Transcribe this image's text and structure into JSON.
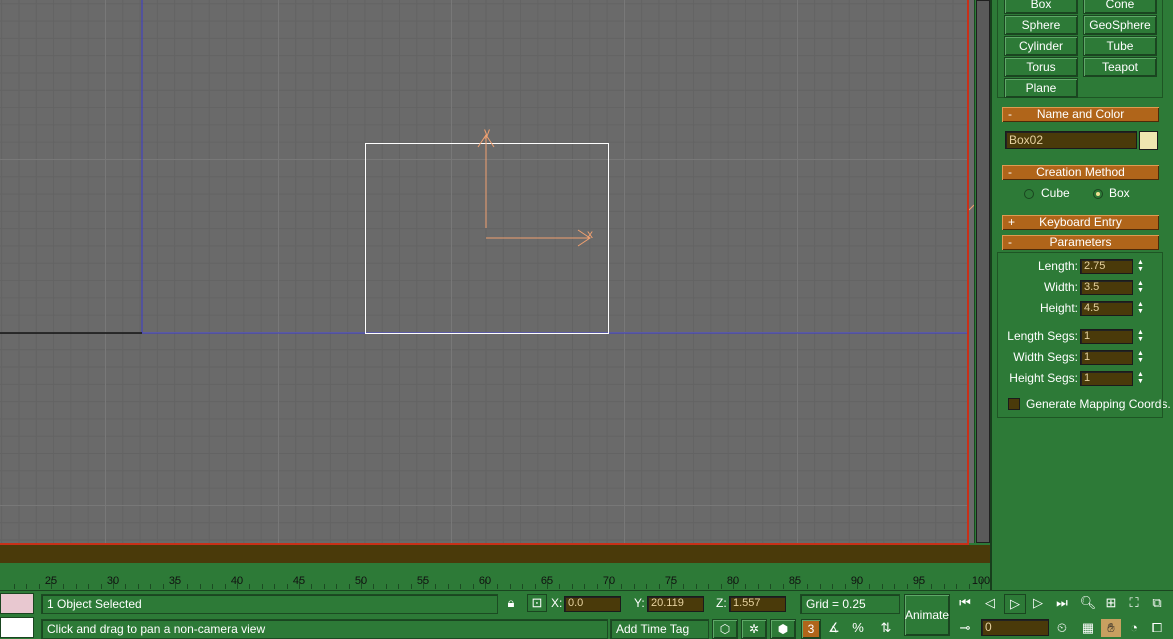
{
  "viewport": {
    "gizmo_y_label": "y",
    "gizmo_x_label": "x"
  },
  "panel": {
    "object_types": [
      "Box",
      "Cone",
      "Sphere",
      "GeoSphere",
      "Cylinder",
      "Tube",
      "Torus",
      "Teapot",
      "Plane"
    ],
    "name_and_color": {
      "sign": "-",
      "title": "Name and Color",
      "name_value": "Box02",
      "color": "#f0e6b0"
    },
    "creation_method": {
      "sign": "-",
      "title": "Creation Method",
      "option_cube": "Cube",
      "option_box": "Box",
      "selected": "Box"
    },
    "keyboard_entry": {
      "sign": "+",
      "title": "Keyboard Entry"
    },
    "parameters": {
      "sign": "-",
      "title": "Parameters",
      "length_label": "Length:",
      "length": "2.75",
      "width_label": "Width:",
      "width": "3.5",
      "height_label": "Height:",
      "height": "4.5",
      "length_segs_label": "Length Segs:",
      "length_segs": "1",
      "width_segs_label": "Width Segs:",
      "width_segs": "1",
      "height_segs_label": "Height Segs:",
      "height_segs": "1",
      "mapping_label": "Generate Mapping Coords.",
      "mapping_checked": false
    }
  },
  "timeline": {
    "ticks": [
      "25",
      "30",
      "35",
      "40",
      "45",
      "50",
      "55",
      "60",
      "65",
      "70",
      "75",
      "80",
      "85",
      "90",
      "95",
      "100"
    ]
  },
  "status": {
    "selection": "1 Object Selected",
    "prompt": "Click and drag to pan a non-camera view",
    "x_label": "X:",
    "x_value": "0.0",
    "y_label": "Y:",
    "y_value": "20.119",
    "z_label": "Z:",
    "z_value": "1.557",
    "grid": "Grid = 0.25",
    "animate": "Animate",
    "add_time_tag": "Add Time Tag",
    "frame": "0"
  },
  "colors": {
    "ui_green": "#2d7a37",
    "rollout_orange": "#b0651a",
    "field_brown": "#4a3a0a",
    "viewport_border": "#c83018"
  }
}
